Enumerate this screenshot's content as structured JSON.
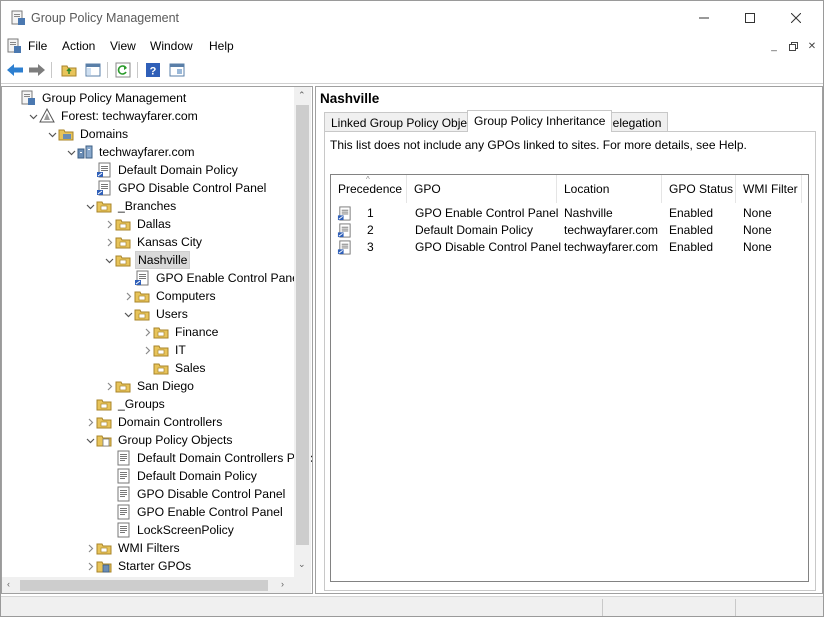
{
  "window": {
    "title": "Group Policy Management"
  },
  "menu": [
    "File",
    "Action",
    "View",
    "Window",
    "Help"
  ],
  "toolbar": [
    "back-icon",
    "forward-icon",
    "up-folder-icon",
    "show-hide-console-tree-icon",
    "refresh-icon",
    "help-icon",
    "properties-icon"
  ],
  "tree": [
    {
      "label": "Group Policy Management",
      "indent": 0,
      "chev": "",
      "icon": "gpm"
    },
    {
      "label": "Forest: techwayfarer.com",
      "indent": 1,
      "chev": "open",
      "icon": "forest"
    },
    {
      "label": "Domains",
      "indent": 2,
      "chev": "open",
      "icon": "domains"
    },
    {
      "label": "techwayfarer.com",
      "indent": 3,
      "chev": "open",
      "icon": "domain"
    },
    {
      "label": "Default Domain Policy",
      "indent": 4,
      "chev": "",
      "icon": "gpo-link"
    },
    {
      "label": "GPO Disable Control Panel",
      "indent": 4,
      "chev": "",
      "icon": "gpo-link"
    },
    {
      "label": "_Branches",
      "indent": 4,
      "chev": "open",
      "icon": "ou"
    },
    {
      "label": "Dallas",
      "indent": 5,
      "chev": "closed",
      "icon": "ou"
    },
    {
      "label": "Kansas City",
      "indent": 5,
      "chev": "closed",
      "icon": "ou"
    },
    {
      "label": "Nashville",
      "indent": 5,
      "chev": "open",
      "icon": "ou",
      "selected": true
    },
    {
      "label": "GPO Enable Control Panel",
      "indent": 6,
      "chev": "",
      "icon": "gpo-link"
    },
    {
      "label": "Computers",
      "indent": 6,
      "chev": "closed",
      "icon": "ou"
    },
    {
      "label": "Users",
      "indent": 6,
      "chev": "open",
      "icon": "ou"
    },
    {
      "label": "Finance",
      "indent": 7,
      "chev": "closed",
      "icon": "ou"
    },
    {
      "label": "IT",
      "indent": 7,
      "chev": "closed",
      "icon": "ou"
    },
    {
      "label": "Sales",
      "indent": 7,
      "chev": "",
      "icon": "ou"
    },
    {
      "label": "San Diego",
      "indent": 5,
      "chev": "closed",
      "icon": "ou"
    },
    {
      "label": "_Groups",
      "indent": 4,
      "chev": "",
      "icon": "ou"
    },
    {
      "label": "Domain Controllers",
      "indent": 4,
      "chev": "closed",
      "icon": "ou"
    },
    {
      "label": "Group Policy Objects",
      "indent": 4,
      "chev": "open",
      "icon": "gpo-folder"
    },
    {
      "label": "Default Domain Controllers Policy",
      "indent": 5,
      "chev": "",
      "icon": "gpo"
    },
    {
      "label": "Default Domain Policy",
      "indent": 5,
      "chev": "",
      "icon": "gpo"
    },
    {
      "label": "GPO Disable Control Panel",
      "indent": 5,
      "chev": "",
      "icon": "gpo"
    },
    {
      "label": "GPO Enable Control Panel",
      "indent": 5,
      "chev": "",
      "icon": "gpo"
    },
    {
      "label": "LockScreenPolicy",
      "indent": 5,
      "chev": "",
      "icon": "gpo"
    },
    {
      "label": "WMI Filters",
      "indent": 4,
      "chev": "closed",
      "icon": "ou"
    },
    {
      "label": "Starter GPOs",
      "indent": 4,
      "chev": "closed",
      "icon": "starter"
    }
  ],
  "right": {
    "title": "Nashville",
    "tabs": [
      "Linked Group Policy Objects",
      "Group Policy Inheritance",
      "Delegation"
    ],
    "active_tab": 1,
    "note": "This list does not include any GPOs linked to sites. For more details, see Help.",
    "columns": [
      "Precedence",
      "GPO",
      "Location",
      "GPO Status",
      "WMI Filter"
    ],
    "rows": [
      [
        "1",
        "GPO Enable Control Panel",
        "Nashville",
        "Enabled",
        "None"
      ],
      [
        "2",
        "Default Domain Policy",
        "techwayfarer.com",
        "Enabled",
        "None"
      ],
      [
        "3",
        "GPO Disable Control Panel",
        "techwayfarer.com",
        "Enabled",
        "None"
      ]
    ]
  },
  "colors": {
    "folder": "#e8c45a",
    "accent": "#1e6fc0",
    "selected": "#d9d9d9"
  }
}
